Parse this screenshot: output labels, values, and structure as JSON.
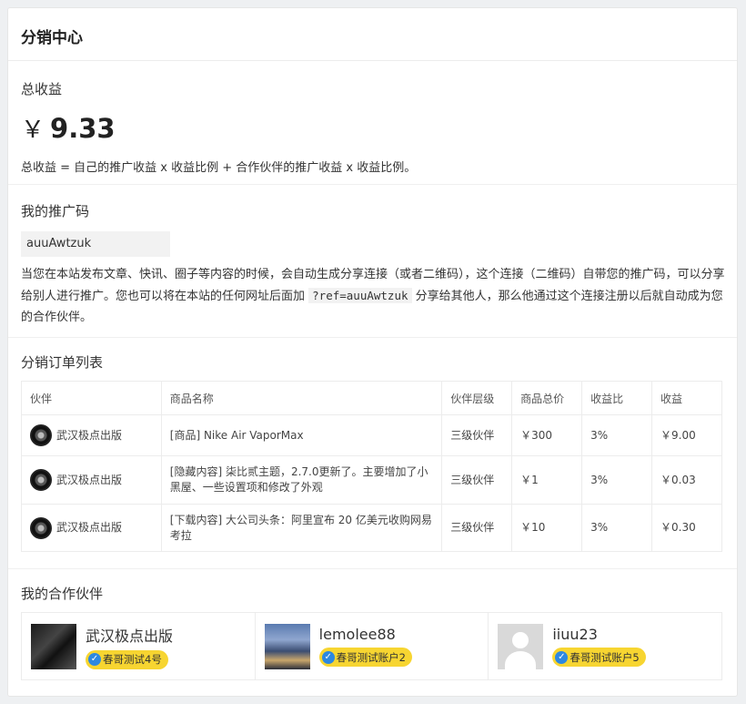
{
  "header": {
    "title": "分销中心"
  },
  "total": {
    "heading": "总收益",
    "currency": "￥",
    "amount": "9.33",
    "formula": "总收益 = 自己的推广收益 x 收益比例 + 合作伙伴的推广收益 x 收益比例。"
  },
  "promo": {
    "heading": "我的推广码",
    "code": "auuAwtzuk",
    "desc_before": "当您在本站发布文章、快讯、圈子等内容的时候，会自动生成分享连接（或者二维码），这个连接（二维码）自带您的推广码，可以分享给别人进行推广。您也可以将在本站的任何网址后面加 ",
    "ref_param": "?ref=auuAwtzuk",
    "desc_after": " 分享给其他人，那么他通过这个连接注册以后就自动成为您的合作伙伴。"
  },
  "orders": {
    "heading": "分销订单列表",
    "columns": [
      "伙伴",
      "商品名称",
      "伙伴层级",
      "商品总价",
      "收益比",
      "收益"
    ],
    "rows": [
      {
        "partner": "武汉极点出版",
        "product": "[商品] Nike Air VaporMax",
        "level": "三级伙伴",
        "price": "￥300",
        "ratio": "3%",
        "earning": "￥9.00"
      },
      {
        "partner": "武汉极点出版",
        "product": "[隐藏内容] 柒比贰主题，2.7.0更新了。主要增加了小黑屋、一些设置项和修改了外观",
        "level": "三级伙伴",
        "price": "￥1",
        "ratio": "3%",
        "earning": "￥0.03"
      },
      {
        "partner": "武汉极点出版",
        "product": "[下载内容] 大公司头条：阿里宣布 20 亿美元收购网易考拉",
        "level": "三级伙伴",
        "price": "￥10",
        "ratio": "3%",
        "earning": "￥0.30"
      }
    ]
  },
  "partners": {
    "heading": "我的合作伙伴",
    "items": [
      {
        "name": "武汉极点出版",
        "badge": "春哥测试4号"
      },
      {
        "name": "lemolee88",
        "badge": "春哥测试账户2"
      },
      {
        "name": "iiuu23",
        "badge": "春哥测试账户5"
      }
    ]
  },
  "icons": {
    "verify": "check-badge-icon"
  },
  "colors": {
    "badge_bg": "#f7d531",
    "verify_blue": "#2d88e0"
  }
}
